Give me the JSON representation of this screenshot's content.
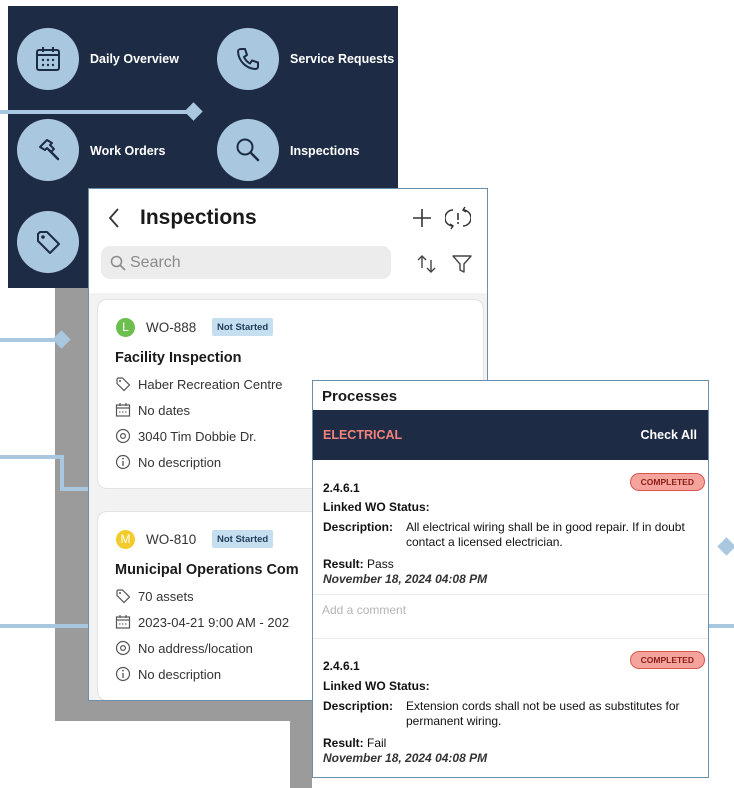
{
  "menu": {
    "items": [
      {
        "label": "Daily Overview",
        "icon": "calendar-icon"
      },
      {
        "label": "Service Requests",
        "icon": "phone-icon"
      },
      {
        "label": "Work Orders",
        "icon": "hammer-icon"
      },
      {
        "label": "Inspections",
        "icon": "search-icon"
      },
      {
        "icon": "tag-icon"
      }
    ]
  },
  "inspections": {
    "title": "Inspections",
    "search_placeholder": "Search",
    "cards": [
      {
        "avatar": "L",
        "avatar_color": "#6cbf4f",
        "wo": "WO-888",
        "status": "Not Started",
        "title": "Facility Inspection",
        "asset": "Haber Recreation Centre",
        "dates": "No dates",
        "location": "3040 Tim Dobbie Dr.",
        "description": "No description"
      },
      {
        "avatar": "M",
        "avatar_color": "#f3cc2c",
        "wo": "WO-810",
        "status": "Not Started",
        "title": "Municipal Operations Com",
        "asset": "70 assets",
        "dates": "2023-04-21 9:00 AM - 202",
        "location": "No address/location",
        "description": "No description"
      }
    ]
  },
  "processes": {
    "title": "Processes",
    "category": "ELECTRICAL",
    "check_all": "Check All",
    "comment_placeholder": "Add a comment",
    "items": [
      {
        "number": "2.4.6.1",
        "status_badge": "COMPLETED",
        "linked_label": "Linked WO Status:",
        "description_label": "Description:",
        "description": "All electrical wiring shall be in good repair. If in doubt contact a licensed electrician.",
        "result_label": "Result:",
        "result": "Pass",
        "date": "November 18, 2024 04:08 PM"
      },
      {
        "number": "2.4.6.1",
        "status_badge": "COMPLETED",
        "linked_label": "Linked WO Status:",
        "description_label": "Description:",
        "description": "Extension cords shall not be used as substitutes for permanent wiring.",
        "result_label": "Result:",
        "result": "Fail",
        "date": "November 18, 2024 04:08 PM"
      }
    ]
  },
  "colors": {
    "navy": "#1e2b44",
    "light_blue": "#a9c8df",
    "category_red": "#f2827a",
    "badge_blue": "#c6dff0"
  }
}
